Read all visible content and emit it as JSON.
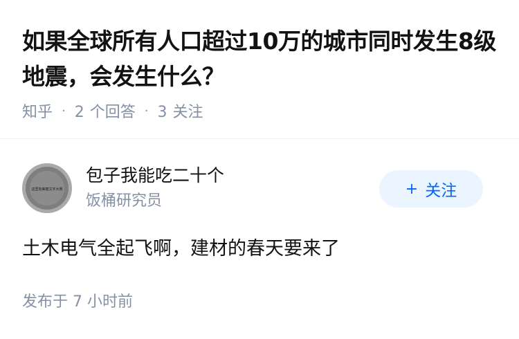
{
  "question": {
    "title": "如果全球所有人口超过10万的城市同时发生8级地震，会发生什么？",
    "source": "知乎",
    "answer_count": "2",
    "answer_label": "个回答",
    "follower_count": "3",
    "follower_label": "关注"
  },
  "answer": {
    "author": {
      "name": "包子我能吃二十个",
      "headline": "饭桶研究员",
      "avatar_text": "这里有美丽文字大赛"
    },
    "follow_button": {
      "icon": "plus-icon",
      "icon_glyph": "+",
      "label": "关注"
    },
    "content": "土木电气全起飞啊，建材的春天要来了",
    "published": "发布于 7 小时前"
  },
  "colors": {
    "title": "#121212",
    "muted": "#8590a6",
    "accent": "#0066ff",
    "accent_bg": "#ebf5ff",
    "divider": "#f0f2f7"
  }
}
